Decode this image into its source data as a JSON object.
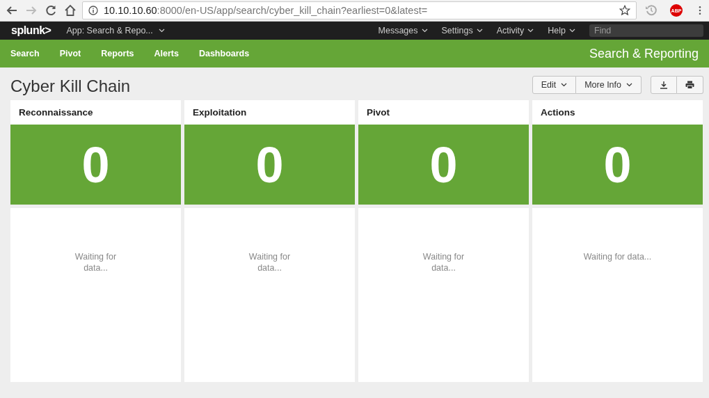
{
  "browser": {
    "url_host": "10.10.10.60",
    "url_path": ":8000/en-US/app/search/cyber_kill_chain?earliest=0&latest=",
    "extension_badge": "ABP"
  },
  "app_bar": {
    "logo": "splunk>",
    "app_menu": "App: Search & Repo...",
    "menus": [
      "Messages",
      "Settings",
      "Activity",
      "Help"
    ],
    "search": {
      "placeholder": "Find"
    }
  },
  "nav": {
    "items": [
      "Search",
      "Pivot",
      "Reports",
      "Alerts",
      "Dashboards"
    ],
    "app_title": "Search & Reporting"
  },
  "dashboard": {
    "title": "Cyber Kill Chain",
    "buttons": [
      "Edit",
      "More Info"
    ]
  },
  "panels": [
    {
      "title": "Reconnaissance",
      "value": "0",
      "message_lines": [
        "Waiting for",
        "data..."
      ]
    },
    {
      "title": "Exploitation",
      "value": "0",
      "message_lines": [
        "Waiting for",
        "data..."
      ]
    },
    {
      "title": "Pivot",
      "value": "0",
      "message_lines": [
        "Waiting for",
        "data..."
      ]
    },
    {
      "title": "Actions",
      "value": "0",
      "message_lines": [
        "Waiting for data..."
      ]
    }
  ]
}
